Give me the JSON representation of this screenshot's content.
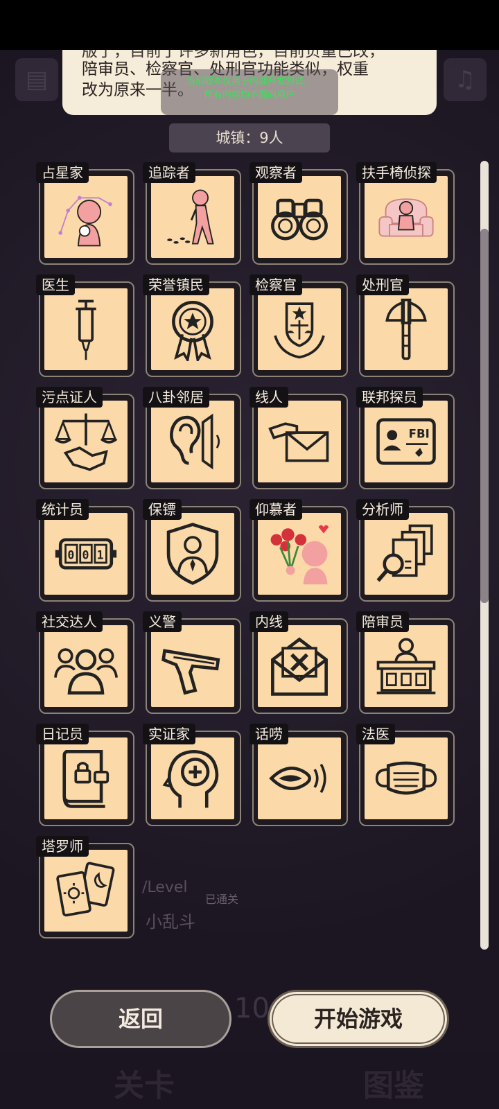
{
  "notice": {
    "line0": "版了，目前了许多新角色，目前负重已改，",
    "line1": "陪审员、检察官、处刑官功能类似，权重",
    "line2": "改为原来一半。"
  },
  "watermark": {
    "line1": "当前版本仅用于内部开发测试，",
    "line2": "所有内容均不面向用户"
  },
  "town_header": "城镇：9人",
  "roles": [
    {
      "label": "占星家",
      "icon": "astrologer-icon"
    },
    {
      "label": "追踪者",
      "icon": "tracker-icon"
    },
    {
      "label": "观察者",
      "icon": "binoculars-icon"
    },
    {
      "label": "扶手椅侦探",
      "icon": "armchair-icon"
    },
    {
      "label": "医生",
      "icon": "syringe-icon"
    },
    {
      "label": "荣誉镇民",
      "icon": "medal-icon"
    },
    {
      "label": "检察官",
      "icon": "justice-emblem-icon"
    },
    {
      "label": "处刑官",
      "icon": "axe-icon"
    },
    {
      "label": "污点证人",
      "icon": "scales-handshake-icon"
    },
    {
      "label": "八卦邻居",
      "icon": "ear-icon"
    },
    {
      "label": "线人",
      "icon": "envelope-hand-icon"
    },
    {
      "label": "联邦探员",
      "icon": "fbi-badge-icon"
    },
    {
      "label": "统计员",
      "icon": "counter-icon"
    },
    {
      "label": "保镖",
      "icon": "shield-person-icon"
    },
    {
      "label": "仰慕者",
      "icon": "roses-icon"
    },
    {
      "label": "分析师",
      "icon": "documents-magnifier-icon"
    },
    {
      "label": "社交达人",
      "icon": "crowd-icon"
    },
    {
      "label": "义警",
      "icon": "pistol-icon"
    },
    {
      "label": "内线",
      "icon": "mail-x-icon"
    },
    {
      "label": "陪审员",
      "icon": "jury-box-icon"
    },
    {
      "label": "日记员",
      "icon": "locked-diary-icon"
    },
    {
      "label": "实证家",
      "icon": "head-plus-icon"
    },
    {
      "label": "话唠",
      "icon": "talking-mouth-icon"
    },
    {
      "label": "法医",
      "icon": "face-mask-icon"
    },
    {
      "label": "塔罗师",
      "icon": "tarot-cards-icon"
    }
  ],
  "background": {
    "level_text": "/Level",
    "passed_text": "已通关",
    "mode_text": "小乱斗",
    "number_text": "10"
  },
  "buttons": {
    "back": "返回",
    "start": "开始游戏"
  },
  "nav": {
    "levels": "关卡",
    "gallery": "图鉴"
  }
}
